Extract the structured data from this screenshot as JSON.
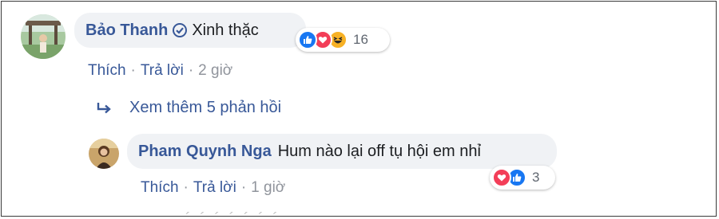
{
  "comment1": {
    "author": "Bảo Thanh",
    "text": "Xinh thặc",
    "reaction_count": "16",
    "reactions": [
      "like-icon",
      "love-icon",
      "haha-icon"
    ],
    "actions": {
      "like": "Thích",
      "reply": "Trả lời",
      "time": "2 giờ",
      "separator": "·"
    }
  },
  "view_more": {
    "label": "Xem thêm 5 phản hồi"
  },
  "reply1": {
    "author": "Pham Quynh Nga",
    "text": "Hum nào lại off tụ hội em nhỉ",
    "reaction_count": "3",
    "reactions": [
      "love-icon",
      "like-icon"
    ],
    "actions": {
      "like": "Thích",
      "reply": "Trả lời",
      "time": "1 giờ",
      "separator": "·"
    }
  },
  "colors": {
    "link_blue": "#385898",
    "like_blue": "#1877f2",
    "love_red": "#f33e58",
    "haha_yellow": "#f7b125",
    "bubble_bg": "#f0f2f5",
    "meta_gray": "#90949c"
  }
}
